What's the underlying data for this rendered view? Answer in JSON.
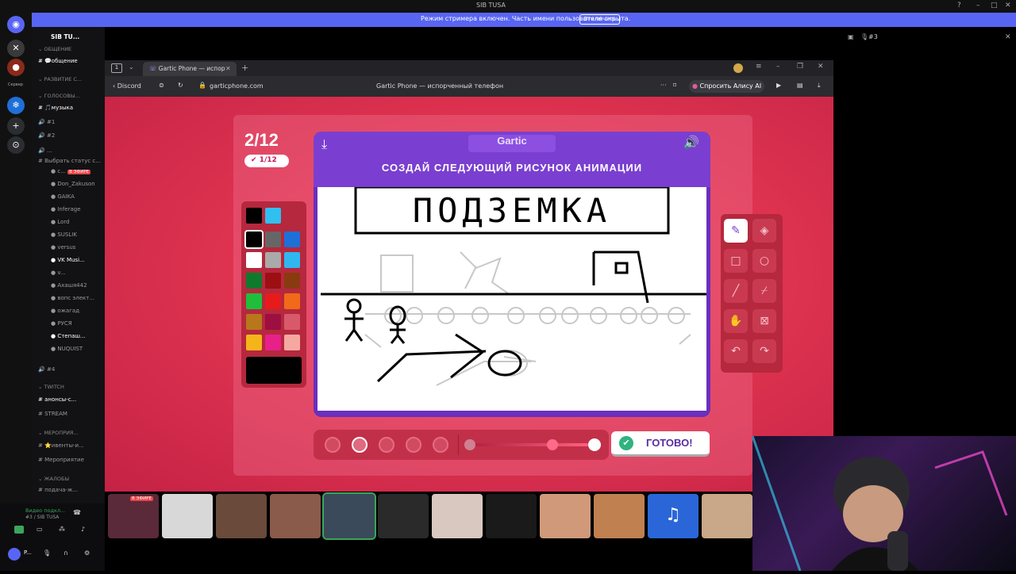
{
  "window": {
    "title": "SIB TUSA"
  },
  "stream_banner": {
    "message": "Режим стримера включен. Часть имени пользователя скрыта.",
    "button": "Отключить"
  },
  "servers": {
    "label": "Сервер"
  },
  "channels": {
    "server_name": "SIB TU...",
    "items": [
      {
        "label": "ОБЩЕНИЕ",
        "kind": "category"
      },
      {
        "label": "💬общение",
        "kind": "text",
        "bright": true
      },
      {
        "label": "РАЗВИТИЕ С...",
        "kind": "category"
      },
      {
        "label": "ГОЛОСОВЫ...",
        "kind": "category"
      },
      {
        "label": "🎵музыка",
        "kind": "text",
        "bright": true
      },
      {
        "label": "#1",
        "kind": "voice"
      },
      {
        "label": "#2",
        "kind": "voice"
      },
      {
        "label": "...",
        "kind": "voice"
      },
      {
        "label": "Выбрать статус с...",
        "kind": "status"
      },
      {
        "label": "с...",
        "kind": "user",
        "live": "В ЭФИРЕ"
      },
      {
        "label": "Don_Zakuson",
        "kind": "user"
      },
      {
        "label": "GAIKA",
        "kind": "user"
      },
      {
        "label": "Inferage",
        "kind": "user"
      },
      {
        "label": "Lord",
        "kind": "user"
      },
      {
        "label": "SUSLIK",
        "kind": "user"
      },
      {
        "label": "versus",
        "kind": "user"
      },
      {
        "label": "VK Musi...",
        "kind": "user",
        "bright": true
      },
      {
        "label": "v...",
        "kind": "user"
      },
      {
        "label": "Ахашя442",
        "kind": "user"
      },
      {
        "label": "вопс элект...",
        "kind": "user"
      },
      {
        "label": "ожагад",
        "kind": "user"
      },
      {
        "label": "РУСЯ",
        "kind": "user"
      },
      {
        "label": "Степаш...",
        "kind": "user",
        "bright": true
      },
      {
        "label": "NUQUIST",
        "kind": "user"
      },
      {
        "label": "#4",
        "kind": "voice"
      },
      {
        "label": "TWITCH",
        "kind": "category"
      },
      {
        "label": "анонсы-с...",
        "kind": "text",
        "bright": true
      },
      {
        "label": "STREAM",
        "kind": "text"
      },
      {
        "label": "МЕРОПРИЯ...",
        "kind": "category"
      },
      {
        "label": "⭐ивенты-и...",
        "kind": "text"
      },
      {
        "label": "Мероприятие",
        "kind": "text"
      },
      {
        "label": "ЖАЛОБЫ",
        "kind": "category"
      },
      {
        "label": "подача-ж...",
        "kind": "text"
      }
    ]
  },
  "user_panel": {
    "voice_status": "Видео подкл...",
    "voice_channel": "#3 / SIB TUSA",
    "user": "P..."
  },
  "chat_panel": {
    "channel": "#3"
  },
  "browser": {
    "tab_title": "Gartic Phone — испор",
    "tab_count": "1",
    "back_label": "Discord",
    "url": "garticphone.com",
    "page_title": "Gartic Phone — испорченный телефон",
    "alice_button": "Спросить Алису AI"
  },
  "game": {
    "round": "2/12",
    "done_count": "1/12",
    "logo": "Gartic",
    "prompt": "СОЗДАЙ СЛЕДУЮЩИЙ РИСУНОК АНИМАЦИИ",
    "drawing_text": "ПОДЗЕМКА",
    "done_button": "ГОТОВО!",
    "palette": [
      [
        "#000000",
        "#2fc0f0"
      ],
      [
        "#000000",
        "#666666",
        "#1f6fd8"
      ],
      [
        "#ffffff",
        "#aaaaaa",
        "#2fb8f0"
      ],
      [
        "#0f7a2c",
        "#9c0f12",
        "#8a3a0f"
      ],
      [
        "#1fbf3c",
        "#e81b1b",
        "#f06a1a"
      ],
      [
        "#b7771a",
        "#9c0f40",
        "#d85a6a"
      ],
      [
        "#f5b51a",
        "#e8208a",
        "#f5a8a0"
      ]
    ],
    "current_color": "#000000",
    "tools": [
      "pencil-icon",
      "eraser-icon",
      "rectangle-icon",
      "ellipse-icon",
      "line-icon",
      "eyedropper-icon",
      "stamp-icon",
      "clear-icon",
      "undo-icon",
      "redo-icon"
    ],
    "brush_sizes": 5,
    "selected_size": 1,
    "opacity": 0.8
  },
  "thumbnails": {
    "live_label": "В ЭФИРЕ",
    "count": 12
  }
}
